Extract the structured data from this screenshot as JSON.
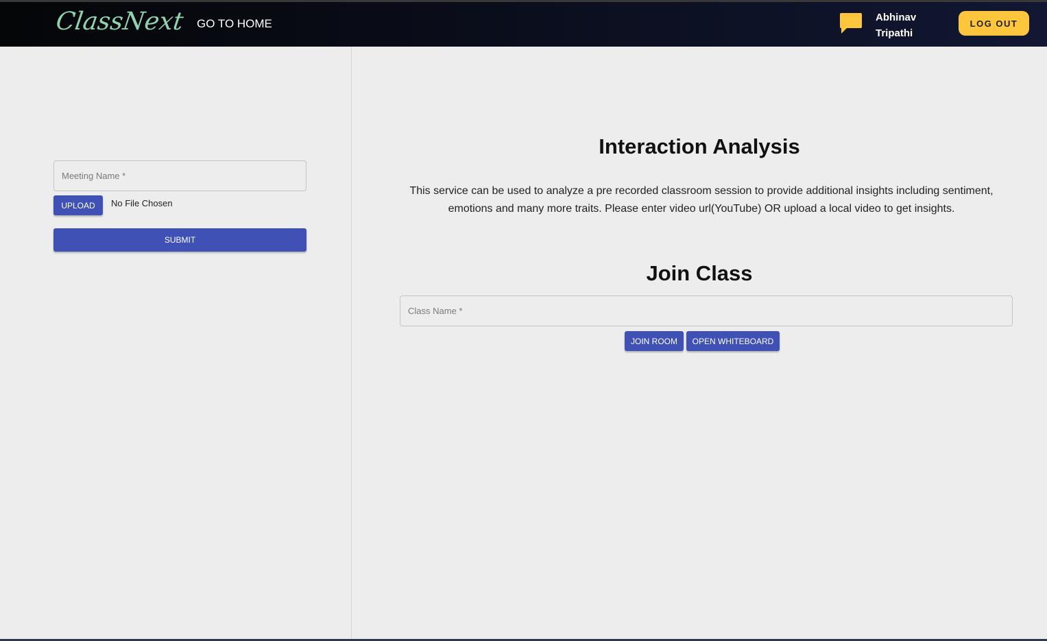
{
  "navbar": {
    "logo_text": "ClassNext",
    "home_link": "GO TO HOME",
    "chat_icon": "chat-bubble-icon",
    "user_first_name": "Abhinav",
    "user_last_name": "Tripathi",
    "logout_label": "LOG OUT"
  },
  "interaction_form": {
    "meeting_name_placeholder": "Meeting Name *",
    "meeting_name_value": "",
    "upload_label": "UPLOAD",
    "file_status": "No File Chosen",
    "submit_label": "SUBMIT"
  },
  "interaction_analysis": {
    "title": "Interaction Analysis",
    "description": "This service can be used to analyze a pre recorded classroom session to provide additional insights including sentiment, emotions and many more traits. Please enter video url(YouTube) OR upload a local video to get insights."
  },
  "join_class": {
    "title": "Join Class",
    "class_name_placeholder": "Class Name *",
    "class_name_value": "",
    "join_room_label": "JOIN ROOM",
    "open_whiteboard_label": "OPEN WHITEBOARD"
  },
  "colors": {
    "navbar_bg": "#0a0d1a",
    "logo": "#8fd3b0",
    "accent_yellow": "#fec63c",
    "primary_button": "#3f51b5",
    "page_bg": "#ededed"
  }
}
